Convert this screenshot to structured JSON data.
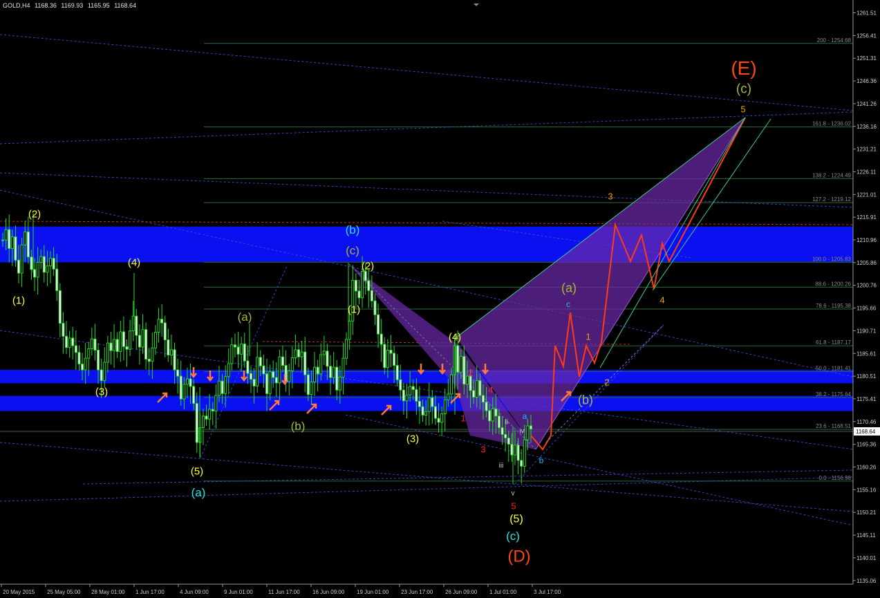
{
  "header": {
    "symbol": "GOLD,H4",
    "open": "1168.36",
    "high": "1169.93",
    "low": "1165.95",
    "close": "1168.64"
  },
  "current_price": "1168.64",
  "colors": {
    "background": "#000000",
    "candles": "#22dd22",
    "zones": "#0a10f0",
    "fib_line": "#2b6b38",
    "trend_dashed": "#3a4fd8",
    "pattern_fill": "#6a2aa8",
    "projection": "#ff3a16",
    "channel": "#3ecf8e",
    "arrow": "#ff7a3a"
  },
  "chart_data": {
    "type": "candlestick",
    "title": "GOLD,H4",
    "y_range": [
      1135.66,
      1263.0
    ],
    "y_ticks": [
      "1261.51",
      "1256.41",
      "1251.31",
      "1246.36",
      "1241.26",
      "1236.16",
      "1231.21",
      "1226.11",
      "1221.01",
      "1215.91",
      "1210.96",
      "1205.86",
      "1200.76",
      "1195.66",
      "1190.71",
      "1185.61",
      "1180.51",
      "1175.41",
      "1170.46",
      "1165.36",
      "1160.26",
      "1155.16",
      "1150.21",
      "1145.11",
      "1140.01",
      "1135.06"
    ],
    "x_ticks": [
      "20 May 2015",
      "25 May 05:00",
      "28 May 01:00",
      "1 Jun 17:00",
      "4 Jun 09:00",
      "9 Jun 01:00",
      "11 Jun 17:00",
      "16 Jun 09:00",
      "19 Jun 01:00",
      "23 Jun 17:00",
      "26 Jun 09:00",
      "1 Jul 01:00",
      "3 Jul 17:00"
    ],
    "fib_levels": [
      {
        "label": "200 - 1254.68",
        "value": 1254.68
      },
      {
        "label": "161.8 - 1236.02",
        "value": 1236.02
      },
      {
        "label": "138.2 - 1224.49",
        "value": 1224.49
      },
      {
        "label": "127.2 - 1219.12",
        "value": 1219.12
      },
      {
        "label": "100.0 - 1205.83",
        "value": 1205.83
      },
      {
        "label": "88.6 - 1200.26",
        "value": 1200.26
      },
      {
        "label": "78.6 - 1195.38",
        "value": 1195.38
      },
      {
        "label": "61.8 - 1187.17",
        "value": 1187.17
      },
      {
        "label": "50.0 - 1181.41",
        "value": 1181.41
      },
      {
        "label": "38.2 - 1175.64",
        "value": 1175.64
      },
      {
        "label": "23.6 - 1168.51",
        "value": 1168.51
      },
      {
        "label": "0.0 - 1156.98",
        "value": 1156.98
      }
    ],
    "zones": [
      {
        "from": 1205.8,
        "to": 1213.8
      },
      {
        "from": 1178.8,
        "to": 1181.8
      },
      {
        "from": 1172.6,
        "to": 1176.0
      }
    ],
    "close_series": [
      1210.8,
      1213.1,
      1208.9,
      1211.5,
      1206.3,
      1203.4,
      1209.7,
      1212.6,
      1207.0,
      1204.2,
      1202.5,
      1205.8,
      1207.1,
      1203.6,
      1205.0,
      1206.7,
      1204.3,
      1199.5,
      1192.2,
      1189.3,
      1186.8,
      1188.9,
      1187.2,
      1185.7,
      1183.1,
      1181.8,
      1184.4,
      1186.5,
      1188.7,
      1186.2,
      1181.8,
      1179.4,
      1183.5,
      1187.8,
      1186.1,
      1188.6,
      1185.9,
      1190.3,
      1187.0,
      1186.4,
      1190.5,
      1193.8,
      1189.5,
      1186.9,
      1190.8,
      1184.2,
      1183.7,
      1186.7,
      1190.2,
      1193.1,
      1192.3,
      1188.5,
      1185.1,
      1186.3,
      1181.8,
      1180.4,
      1175.3,
      1178.6,
      1179.8,
      1178.1,
      1174.3,
      1165.6,
      1168.9,
      1171.5,
      1170.8,
      1173.0,
      1172.6,
      1176.1,
      1179.3,
      1176.5,
      1180.3,
      1183.2,
      1187.4,
      1186.9,
      1185.3,
      1187.6,
      1183.8,
      1181.0,
      1179.7,
      1178.2,
      1184.6,
      1182.7,
      1180.9,
      1176.5,
      1181.4,
      1180.1,
      1178.9,
      1184.7,
      1182.8,
      1179.2,
      1181.6,
      1184.5,
      1186.3,
      1184.7,
      1185.8,
      1180.7,
      1176.3,
      1179.1,
      1182.4,
      1180.9,
      1185.2,
      1186.0,
      1182.6,
      1180.1,
      1182.4,
      1177.3,
      1180.2,
      1184.4,
      1188.6,
      1192.7,
      1201.8,
      1199.4,
      1197.9,
      1203.8,
      1201.7,
      1199.5,
      1197.2,
      1194.1,
      1189.8,
      1187.5,
      1182.3,
      1186.2,
      1185.5,
      1182.8,
      1179.6,
      1177.3,
      1174.9,
      1176.2,
      1178.1,
      1177.4,
      1174.8,
      1173.6,
      1171.7,
      1172.5,
      1175.6,
      1173.6,
      1171.0,
      1170.1,
      1172.0,
      1175.1,
      1176.4,
      1180.7,
      1187.2,
      1181.3,
      1184.8,
      1178.6,
      1180.4,
      1177.2,
      1175.7,
      1179.4,
      1176.1,
      1174.6,
      1172.7,
      1170.4,
      1173.1,
      1171.5,
      1168.9,
      1167.4,
      1166.6,
      1165.2,
      1162.8,
      1165.0,
      1161.6,
      1160.3,
      1166.2,
      1169.3,
      1168.6
    ],
    "wave_labels": [
      {
        "text": "(1)",
        "color": "#ffff33"
      },
      {
        "text": "(2)",
        "color": "#ffff33"
      },
      {
        "text": "(3)",
        "color": "#ffff33"
      },
      {
        "text": "(4)",
        "color": "#ffff33"
      },
      {
        "text": "(5)",
        "color": "#ffff33"
      },
      {
        "text": "(a)",
        "color": "#22e4e4"
      },
      {
        "text": "(a)",
        "color": "#a8b832"
      },
      {
        "text": "(b)",
        "color": "#a8b832"
      },
      {
        "text": "(b)",
        "color": "#22e4e4"
      },
      {
        "text": "(c)",
        "color": "#a8b832"
      },
      {
        "text": "(2)",
        "color": "#ffff33"
      },
      {
        "text": "(1)",
        "color": "#ffff33"
      },
      {
        "text": "(4)",
        "color": "#ffff33"
      },
      {
        "text": "(3)",
        "color": "#ffff33"
      },
      {
        "text": "1",
        "color": "#ff2222"
      },
      {
        "text": "2",
        "color": "#ff2222"
      },
      {
        "text": "3",
        "color": "#ff2222"
      },
      {
        "text": "4",
        "color": "#ff2222"
      },
      {
        "text": "5",
        "color": "#ff2222"
      },
      {
        "text": "ii",
        "color": "#d0d0d0"
      },
      {
        "text": "i",
        "color": "#d0d0d0"
      },
      {
        "text": "iii",
        "color": "#d0d0d0"
      },
      {
        "text": "iv",
        "color": "#d0d0d0"
      },
      {
        "text": "v",
        "color": "#d0d0d0"
      },
      {
        "text": "(5)",
        "color": "#ffff33"
      },
      {
        "text": "(c)",
        "color": "#22e4e4"
      },
      {
        "text": "(D)",
        "color": "#ff4411"
      },
      {
        "text": "a",
        "color": "#22bbff"
      },
      {
        "text": "b",
        "color": "#22bbff"
      },
      {
        "text": "c",
        "color": "#22bbff"
      },
      {
        "text": "(a)",
        "color": "#a8b832"
      },
      {
        "text": "(b)",
        "color": "#a8b832"
      },
      {
        "text": "1",
        "color": "#f0a000"
      },
      {
        "text": "2",
        "color": "#f0a000"
      },
      {
        "text": "3",
        "color": "#f0a000"
      },
      {
        "text": "4",
        "color": "#f0a000"
      },
      {
        "text": "5",
        "color": "#f0a000"
      },
      {
        "text": "(c)",
        "color": "#a8b832"
      },
      {
        "text": "(E)",
        "color": "#ff4411"
      }
    ]
  }
}
